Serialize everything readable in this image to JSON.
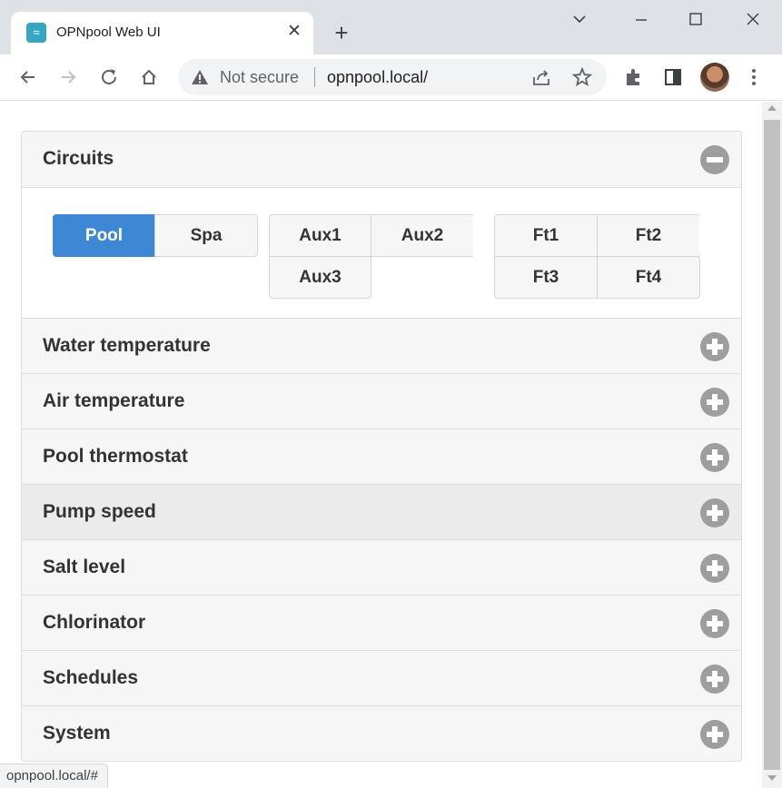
{
  "browser": {
    "tab_title": "OPNpool Web UI",
    "security_label": "Not secure",
    "url": "opnpool.local/",
    "status_url": "opnpool.local/#"
  },
  "circuits": {
    "title": "Circuits",
    "buttons": {
      "pool": "Pool",
      "spa": "Spa",
      "aux1": "Aux1",
      "aux2": "Aux2",
      "aux3": "Aux3",
      "ft1": "Ft1",
      "ft2": "Ft2",
      "ft3": "Ft3",
      "ft4": "Ft4"
    },
    "active": "Pool"
  },
  "sections": [
    {
      "title": "Water temperature"
    },
    {
      "title": "Air temperature"
    },
    {
      "title": "Pool thermostat"
    },
    {
      "title": "Pump speed"
    },
    {
      "title": "Salt level"
    },
    {
      "title": "Chlorinator"
    },
    {
      "title": "Schedules"
    },
    {
      "title": "System"
    }
  ],
  "colors": {
    "accent": "#3d87d4",
    "toggle": "#9e9e9e"
  }
}
